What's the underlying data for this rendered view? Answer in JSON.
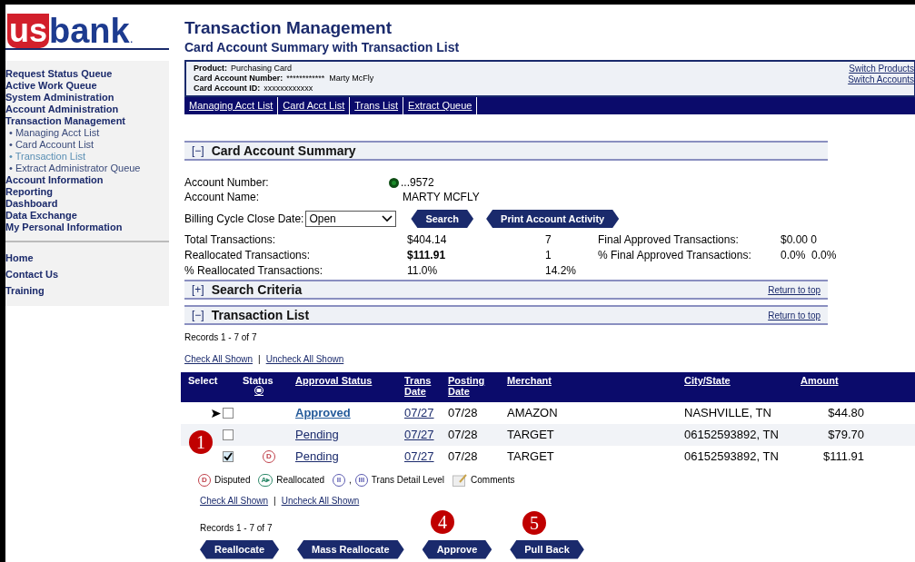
{
  "logo": {
    "red_part": "us",
    "blue_part": "bank",
    "dot": "."
  },
  "sidebar": {
    "items": [
      {
        "label": "Request Status Queue",
        "kind": "section",
        "selected": false
      },
      {
        "label": "Active Work Queue",
        "kind": "section",
        "selected": false
      },
      {
        "label": "System Administration",
        "kind": "section",
        "selected": false
      },
      {
        "label": "Account Administration",
        "kind": "section",
        "selected": false
      },
      {
        "label": "Transaction Management",
        "kind": "section",
        "selected": false
      },
      {
        "label": "Managing Acct List",
        "kind": "sub",
        "selected": false
      },
      {
        "label": "Card Account List",
        "kind": "sub",
        "selected": false
      },
      {
        "label": "Transaction List",
        "kind": "sub",
        "selected": true
      },
      {
        "label": "Extract Administrator Queue",
        "kind": "sub",
        "selected": false
      },
      {
        "label": "Account Information",
        "kind": "section",
        "selected": false
      },
      {
        "label": "Reporting",
        "kind": "section",
        "selected": false
      },
      {
        "label": "Dashboard",
        "kind": "section",
        "selected": false
      },
      {
        "label": "Data Exchange",
        "kind": "section",
        "selected": false
      },
      {
        "label": "My Personal Information",
        "kind": "section",
        "selected": false
      }
    ],
    "sub_bullet": "•",
    "footer_items": [
      "Home",
      "Contact Us",
      "Training"
    ]
  },
  "page": {
    "title": "Transaction Management",
    "subtitle": "Card Account Summary with Transaction List"
  },
  "account_box": {
    "lines": [
      {
        "label": "Product:",
        "value": "Purchasing Card"
      },
      {
        "label": "Card Account Number:",
        "value": "************  Marty McFly"
      },
      {
        "label": "Card Account ID:",
        "value": "xxxxxxxxxxxx"
      }
    ],
    "links": [
      "Switch Products",
      "Switch Accounts"
    ]
  },
  "nav_tabs": [
    "Managing Acct List",
    "Card Acct List",
    "Trans List",
    "Extract Queue"
  ],
  "summary": {
    "toggle": "[−]",
    "title": "Card Account Summary",
    "account_number_label": "Account Number:",
    "account_number": "...9572",
    "account_name_label": "Account Name:",
    "account_name": "MARTY MCFLY",
    "billing_label": "Billing Cycle Close Date:",
    "billing_value": "Open",
    "buttons": [
      "Search",
      "Print Account Activity"
    ],
    "stats": [
      {
        "label": "Total Transactions:",
        "amount": "$404.14",
        "count": "7",
        "extra_label": "Final Approved Transactions:",
        "extra_value": "$0.00 0"
      },
      {
        "label": "Reallocated Transactions:",
        "amount": "$111.91",
        "count": "1",
        "extra_label": "% Final Approved Transactions:",
        "extra_value": "0.0%  0.0%"
      },
      {
        "label": "% Reallocated Transactions:",
        "amount": "11.0%",
        "count": "14.2%"
      }
    ]
  },
  "search_criteria": {
    "toggle": "[+]",
    "title": "Search Criteria",
    "link": "Return to top"
  },
  "transaction_list": {
    "toggle": "[−]",
    "title": "Transaction List",
    "link": "Return to top",
    "records_top": "Records 1 - 7 of 7",
    "check_all": "Check All Shown",
    "separator": "|",
    "uncheck_all": "Uncheck All Shown",
    "columns": [
      {
        "label": "Select",
        "link": false
      },
      {
        "label": "Status",
        "link": false
      },
      {
        "label": "Approval Status",
        "link": true
      },
      {
        "label": "Trans Date",
        "link": true
      },
      {
        "label": "Posting Date",
        "link": true
      },
      {
        "label": "Merchant",
        "link": true
      },
      {
        "label": "City/State",
        "link": true
      },
      {
        "label": "Amount",
        "link": true
      }
    ],
    "rows": [
      {
        "pointer": true,
        "checked": false,
        "status_icon": "",
        "approval": "Approved",
        "approved": true,
        "trans_date": "07/27",
        "posting_date": "07/28",
        "merchant": "AMAZON",
        "city_state": "NASHVILLE, TN",
        "amount": "$44.80"
      },
      {
        "pointer": false,
        "checked": false,
        "status_icon": "",
        "approval": "Pending",
        "approved": false,
        "trans_date": "07/27",
        "posting_date": "07/28",
        "merchant": "TARGET",
        "city_state": "06152593892, TN",
        "amount": "$79.70"
      },
      {
        "pointer": false,
        "checked": true,
        "status_icon": "D",
        "approval": "Pending",
        "approved": false,
        "trans_date": "07/27",
        "posting_date": "07/28",
        "merchant": "TARGET",
        "city_state": "06152593892, TN",
        "amount": "$111.91"
      }
    ],
    "legend": [
      {
        "kind": "disputed",
        "glyph": "D",
        "label": "Disputed"
      },
      {
        "kind": "reallocated",
        "glyph": "A▸",
        "label": "Reallocated"
      },
      {
        "kind": "levels",
        "glyph": "II",
        "glyph2": "III",
        "comma": ",",
        "label": "Trans Detail Level"
      },
      {
        "kind": "comments",
        "label": "Comments"
      }
    ],
    "check_all_bottom": "Check All Shown",
    "uncheck_all_bottom": "Uncheck All Shown",
    "records_bottom": "Records 1 - 7 of 7",
    "actions": [
      "Reallocate",
      "Mass Reallocate",
      "Approve",
      "Pull Back"
    ]
  },
  "callouts": [
    {
      "label": "1"
    },
    {
      "label": "4"
    },
    {
      "label": "5"
    }
  ]
}
